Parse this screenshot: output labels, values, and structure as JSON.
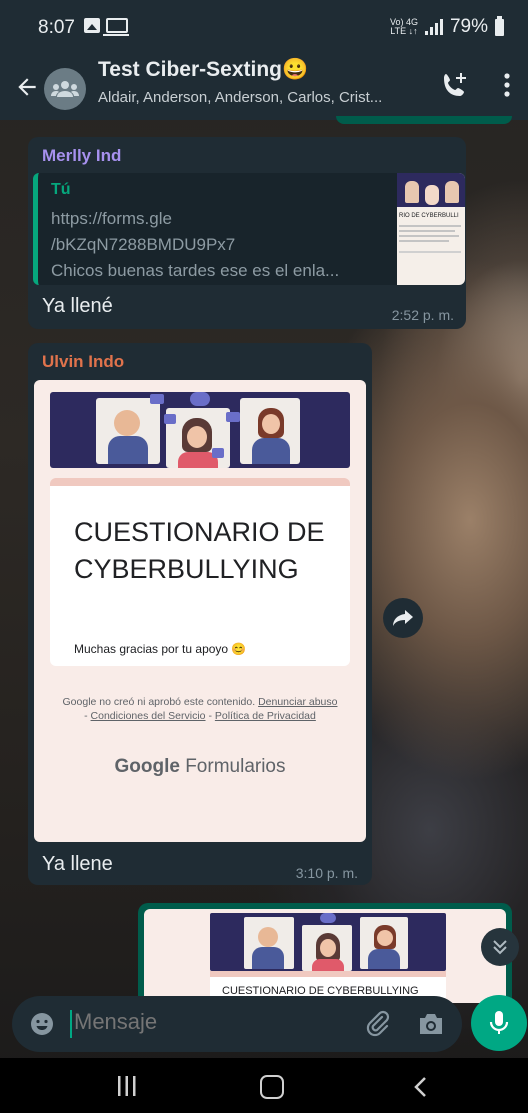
{
  "status_bar": {
    "time": "8:07",
    "network": "Vo) 4G LTE",
    "battery": "79%"
  },
  "header": {
    "title": "Test Ciber-Sexting😀",
    "subtitle": "Aldair, Anderson, Anderson, Carlos, Crist..."
  },
  "messages": [
    {
      "sender": "Merlly Ind",
      "sender_color": "#a791ee",
      "quote": {
        "author": "Tú",
        "lines": [
          "https://forms.gle",
          "/bKZqN7288BMDU9Px7",
          "Chicos buenas tardes ese es el enla..."
        ]
      },
      "text": "Ya llené",
      "time": "2:52 p. m."
    },
    {
      "sender": "Ulvin Indo",
      "sender_color": "#e0734c",
      "preview": {
        "title": "CUESTIONARIO DE CYBERBULLYING",
        "subtitle": "Muchas gracias por tu apoyo 😊",
        "footer_prefix": "Google no creó ni aprobó este contenido.",
        "footer_link1": "Denunciar abuso",
        "footer_link2": "Condiciones del Servicio",
        "footer_link3": "Política de Privacidad",
        "brand_google": "Google",
        "brand_product": "Formularios"
      },
      "text": "Ya llene",
      "time": "3:10 p. m."
    },
    {
      "outgoing": true,
      "preview_title": "CUESTIONARIO DE CYBERBULLYING"
    }
  ],
  "input": {
    "placeholder": "Mensaje"
  },
  "colors": {
    "accent": "#00a884",
    "outgoing_bubble": "#005c4b",
    "incoming_bubble": "#1f2c34",
    "header": "#1f2c34"
  },
  "icons": [
    "back-arrow-icon",
    "group-avatar-icon",
    "add-call-icon",
    "more-vert-icon",
    "forward-icon",
    "chevron-double-down-icon",
    "emoji-icon",
    "attach-icon",
    "camera-icon",
    "mic-icon",
    "nav-recents-icon",
    "nav-home-icon",
    "nav-back-icon"
  ]
}
